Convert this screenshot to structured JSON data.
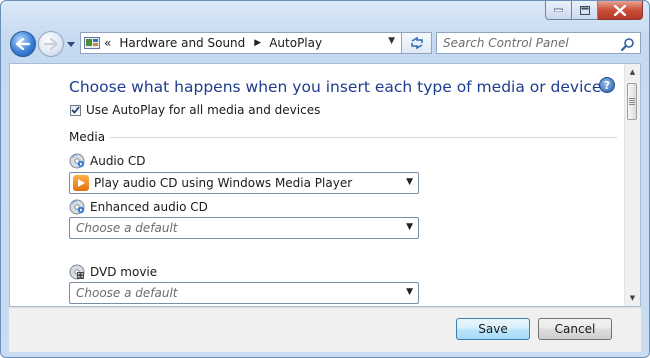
{
  "nav": {
    "breadcrumbs": [
      "Hardware and Sound",
      "AutoPlay"
    ],
    "chevron": "«",
    "search_placeholder": "Search Control Panel"
  },
  "main": {
    "title": "Choose what happens when you insert each type of media or device",
    "autoplay_checkbox": {
      "label": "Use AutoPlay for all media and devices",
      "checked": true
    },
    "section": "Media",
    "items": [
      {
        "label": "Audio CD",
        "icon": "cd-icon",
        "value": "Play audio CD using Windows Media Player",
        "value_icon": "windows-media-player-icon"
      },
      {
        "label": "Enhanced audio CD",
        "icon": "cd-icon",
        "placeholder": "Choose a default"
      },
      {
        "label": "DVD movie",
        "icon": "dvd-icon",
        "placeholder": "Choose a default"
      }
    ]
  },
  "footer": {
    "save_label": "Save",
    "cancel_label": "Cancel"
  },
  "colors": {
    "title": "#1e3d8f",
    "chrome": "#c9dcf1",
    "close": "#c9503a"
  }
}
